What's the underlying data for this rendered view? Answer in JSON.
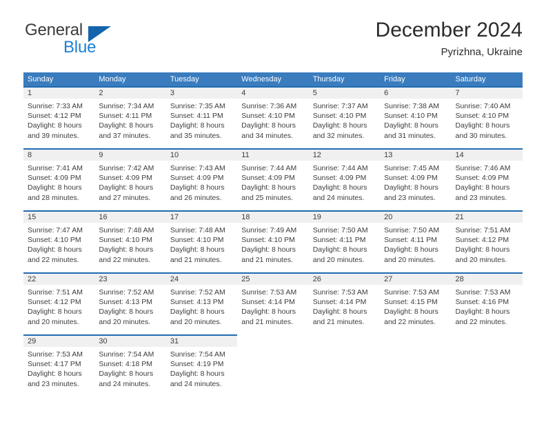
{
  "brand": {
    "name_part1": "General",
    "name_part2": "Blue",
    "accent_color": "#1a7fd4",
    "triangle_color": "#1464ad"
  },
  "header": {
    "title": "December 2024",
    "location": "Pyrizhna, Ukraine"
  },
  "calendar": {
    "header_bg": "#3a7cbe",
    "row_divider_color": "#1f6bb0",
    "daynum_band_bg": "#f0f0f0",
    "day_names": [
      "Sunday",
      "Monday",
      "Tuesday",
      "Wednesday",
      "Thursday",
      "Friday",
      "Saturday"
    ],
    "weeks": [
      [
        {
          "day": "1",
          "lines": [
            "Sunrise: 7:33 AM",
            "Sunset: 4:12 PM",
            "Daylight: 8 hours",
            "and 39 minutes."
          ]
        },
        {
          "day": "2",
          "lines": [
            "Sunrise: 7:34 AM",
            "Sunset: 4:11 PM",
            "Daylight: 8 hours",
            "and 37 minutes."
          ]
        },
        {
          "day": "3",
          "lines": [
            "Sunrise: 7:35 AM",
            "Sunset: 4:11 PM",
            "Daylight: 8 hours",
            "and 35 minutes."
          ]
        },
        {
          "day": "4",
          "lines": [
            "Sunrise: 7:36 AM",
            "Sunset: 4:10 PM",
            "Daylight: 8 hours",
            "and 34 minutes."
          ]
        },
        {
          "day": "5",
          "lines": [
            "Sunrise: 7:37 AM",
            "Sunset: 4:10 PM",
            "Daylight: 8 hours",
            "and 32 minutes."
          ]
        },
        {
          "day": "6",
          "lines": [
            "Sunrise: 7:38 AM",
            "Sunset: 4:10 PM",
            "Daylight: 8 hours",
            "and 31 minutes."
          ]
        },
        {
          "day": "7",
          "lines": [
            "Sunrise: 7:40 AM",
            "Sunset: 4:10 PM",
            "Daylight: 8 hours",
            "and 30 minutes."
          ]
        }
      ],
      [
        {
          "day": "8",
          "lines": [
            "Sunrise: 7:41 AM",
            "Sunset: 4:09 PM",
            "Daylight: 8 hours",
            "and 28 minutes."
          ]
        },
        {
          "day": "9",
          "lines": [
            "Sunrise: 7:42 AM",
            "Sunset: 4:09 PM",
            "Daylight: 8 hours",
            "and 27 minutes."
          ]
        },
        {
          "day": "10",
          "lines": [
            "Sunrise: 7:43 AM",
            "Sunset: 4:09 PM",
            "Daylight: 8 hours",
            "and 26 minutes."
          ]
        },
        {
          "day": "11",
          "lines": [
            "Sunrise: 7:44 AM",
            "Sunset: 4:09 PM",
            "Daylight: 8 hours",
            "and 25 minutes."
          ]
        },
        {
          "day": "12",
          "lines": [
            "Sunrise: 7:44 AM",
            "Sunset: 4:09 PM",
            "Daylight: 8 hours",
            "and 24 minutes."
          ]
        },
        {
          "day": "13",
          "lines": [
            "Sunrise: 7:45 AM",
            "Sunset: 4:09 PM",
            "Daylight: 8 hours",
            "and 23 minutes."
          ]
        },
        {
          "day": "14",
          "lines": [
            "Sunrise: 7:46 AM",
            "Sunset: 4:09 PM",
            "Daylight: 8 hours",
            "and 23 minutes."
          ]
        }
      ],
      [
        {
          "day": "15",
          "lines": [
            "Sunrise: 7:47 AM",
            "Sunset: 4:10 PM",
            "Daylight: 8 hours",
            "and 22 minutes."
          ]
        },
        {
          "day": "16",
          "lines": [
            "Sunrise: 7:48 AM",
            "Sunset: 4:10 PM",
            "Daylight: 8 hours",
            "and 22 minutes."
          ]
        },
        {
          "day": "17",
          "lines": [
            "Sunrise: 7:48 AM",
            "Sunset: 4:10 PM",
            "Daylight: 8 hours",
            "and 21 minutes."
          ]
        },
        {
          "day": "18",
          "lines": [
            "Sunrise: 7:49 AM",
            "Sunset: 4:10 PM",
            "Daylight: 8 hours",
            "and 21 minutes."
          ]
        },
        {
          "day": "19",
          "lines": [
            "Sunrise: 7:50 AM",
            "Sunset: 4:11 PM",
            "Daylight: 8 hours",
            "and 20 minutes."
          ]
        },
        {
          "day": "20",
          "lines": [
            "Sunrise: 7:50 AM",
            "Sunset: 4:11 PM",
            "Daylight: 8 hours",
            "and 20 minutes."
          ]
        },
        {
          "day": "21",
          "lines": [
            "Sunrise: 7:51 AM",
            "Sunset: 4:12 PM",
            "Daylight: 8 hours",
            "and 20 minutes."
          ]
        }
      ],
      [
        {
          "day": "22",
          "lines": [
            "Sunrise: 7:51 AM",
            "Sunset: 4:12 PM",
            "Daylight: 8 hours",
            "and 20 minutes."
          ]
        },
        {
          "day": "23",
          "lines": [
            "Sunrise: 7:52 AM",
            "Sunset: 4:13 PM",
            "Daylight: 8 hours",
            "and 20 minutes."
          ]
        },
        {
          "day": "24",
          "lines": [
            "Sunrise: 7:52 AM",
            "Sunset: 4:13 PM",
            "Daylight: 8 hours",
            "and 20 minutes."
          ]
        },
        {
          "day": "25",
          "lines": [
            "Sunrise: 7:53 AM",
            "Sunset: 4:14 PM",
            "Daylight: 8 hours",
            "and 21 minutes."
          ]
        },
        {
          "day": "26",
          "lines": [
            "Sunrise: 7:53 AM",
            "Sunset: 4:14 PM",
            "Daylight: 8 hours",
            "and 21 minutes."
          ]
        },
        {
          "day": "27",
          "lines": [
            "Sunrise: 7:53 AM",
            "Sunset: 4:15 PM",
            "Daylight: 8 hours",
            "and 22 minutes."
          ]
        },
        {
          "day": "28",
          "lines": [
            "Sunrise: 7:53 AM",
            "Sunset: 4:16 PM",
            "Daylight: 8 hours",
            "and 22 minutes."
          ]
        }
      ],
      [
        {
          "day": "29",
          "lines": [
            "Sunrise: 7:53 AM",
            "Sunset: 4:17 PM",
            "Daylight: 8 hours",
            "and 23 minutes."
          ]
        },
        {
          "day": "30",
          "lines": [
            "Sunrise: 7:54 AM",
            "Sunset: 4:18 PM",
            "Daylight: 8 hours",
            "and 24 minutes."
          ]
        },
        {
          "day": "31",
          "lines": [
            "Sunrise: 7:54 AM",
            "Sunset: 4:19 PM",
            "Daylight: 8 hours",
            "and 24 minutes."
          ]
        },
        {
          "day": "",
          "lines": []
        },
        {
          "day": "",
          "lines": []
        },
        {
          "day": "",
          "lines": []
        },
        {
          "day": "",
          "lines": []
        }
      ]
    ]
  }
}
